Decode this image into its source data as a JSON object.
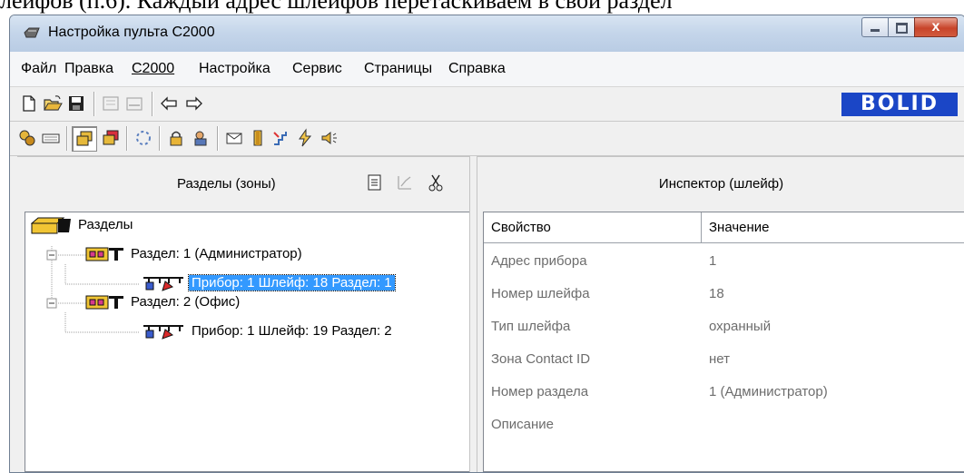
{
  "document_text": "лейфов (п.6). Каждый адрес шлейфов перетаскиваем в свой раздел",
  "window": {
    "title": "Настройка пульта С2000",
    "close_label": "x"
  },
  "menu": [
    "Файл",
    "Правка",
    "С2000",
    "Настройка",
    "Сервис",
    "Страницы",
    "Справка"
  ],
  "toolbar1_icons": [
    "new-file-icon",
    "open-folder-icon",
    "save-icon",
    "export-icon",
    "print-icon",
    "arrow-left-icon",
    "arrow-right-icon"
  ],
  "toolbar2_icons": [
    "devices-icon",
    "keyboard-icon",
    "zones-icon",
    "zones-alt-icon",
    "loops-icon",
    "lock-icon",
    "users-icon",
    "mail-icon",
    "door-icon",
    "stairs-icon",
    "relay-icon",
    "speaker-icon"
  ],
  "brand": {
    "logo_text": "BOLID",
    "logo_color": "#1b46c6"
  },
  "left_panel": {
    "title": "Разделы (зоны)",
    "tools": [
      "properties-icon",
      "chart-icon",
      "cut-icon"
    ],
    "tree": {
      "root": "Разделы",
      "items": [
        {
          "label": "Раздел: 1 (Администратор)",
          "children": [
            "Прибор: 1 Шлейф: 18 Раздел: 1"
          ]
        },
        {
          "label": "Раздел: 2 (Офис)",
          "children": [
            "Прибор: 1 Шлейф: 19 Раздел: 2"
          ]
        }
      ]
    }
  },
  "inspector": {
    "title": "Инспектор (шлейф)",
    "columns": [
      "Свойство",
      "Значение"
    ],
    "rows": [
      {
        "prop": "Адрес прибора",
        "value": "1"
      },
      {
        "prop": "Номер шлейфа",
        "value": "18"
      },
      {
        "prop": "Тип шлейфа",
        "value": "охранный"
      },
      {
        "prop": "Зона Contact ID",
        "value": "нет"
      },
      {
        "prop": "Номер раздела",
        "value": "1 (Администратор)"
      },
      {
        "prop": "Описание",
        "value": ""
      }
    ]
  },
  "colors": {
    "selection": "#3399ff",
    "title_bar": "#c4d5ea"
  }
}
